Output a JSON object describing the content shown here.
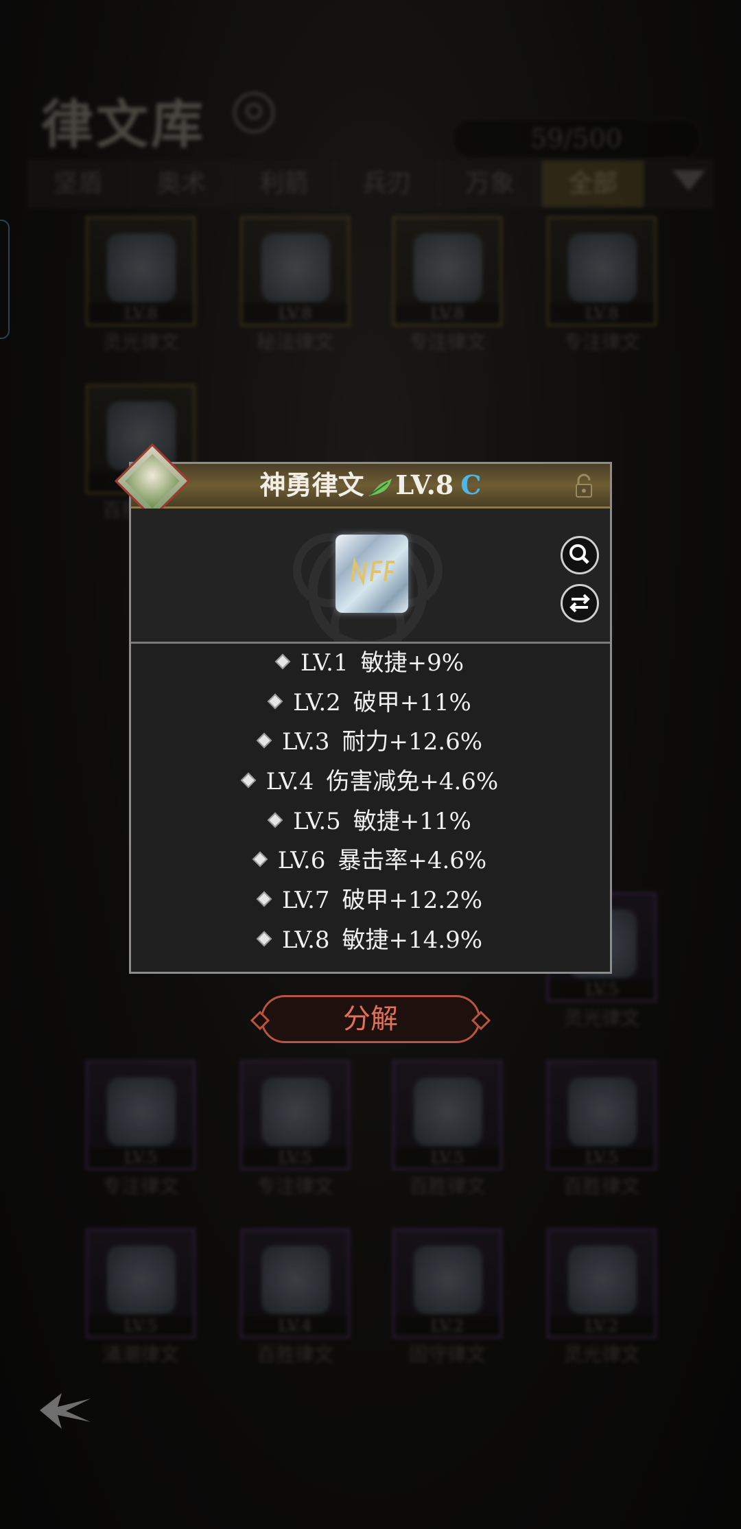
{
  "header": {
    "title": "律文库",
    "counter": "59/500"
  },
  "tabs": [
    {
      "label": "坚盾",
      "active": false
    },
    {
      "label": "奥术",
      "active": false
    },
    {
      "label": "利箭",
      "active": false
    },
    {
      "label": "兵刃",
      "active": false
    },
    {
      "label": "万象",
      "active": false
    },
    {
      "label": "全部",
      "active": true
    }
  ],
  "grid": [
    {
      "lv": "LV.8",
      "name": "灵光律文",
      "rarity": "gold"
    },
    {
      "lv": "LV.8",
      "name": "秘法律文",
      "rarity": "gold"
    },
    {
      "lv": "LV.8",
      "name": "专注律文",
      "rarity": "gold"
    },
    {
      "lv": "LV.8",
      "name": "专注律文",
      "rarity": "gold"
    },
    {
      "lv": "LV.5",
      "name": "百胜律文",
      "rarity": "gold"
    },
    {
      "lv": "LV.5",
      "name": "灵光律文",
      "rarity": "purple"
    },
    {
      "lv": "LV.5",
      "name": "专注律文",
      "rarity": "purple"
    },
    {
      "lv": "LV.5",
      "name": "专注律文",
      "rarity": "purple"
    },
    {
      "lv": "LV.5",
      "name": "百胜律文",
      "rarity": "purple"
    },
    {
      "lv": "LV.5",
      "name": "百胜律文",
      "rarity": "purple"
    },
    {
      "lv": "LV.5",
      "name": "涌潮律文",
      "rarity": "purple"
    },
    {
      "lv": "LV.4",
      "name": "百胜律文",
      "rarity": "purple"
    },
    {
      "lv": "LV.2",
      "name": "固守律文",
      "rarity": "purple"
    },
    {
      "lv": "LV.2",
      "name": "灵光律文",
      "rarity": "purple"
    }
  ],
  "popup": {
    "name": "神勇律文",
    "level": "LV.8",
    "grade": "C",
    "stats": [
      {
        "lv": "LV.1",
        "text": "敏捷+9%"
      },
      {
        "lv": "LV.2",
        "text": "破甲+11%"
      },
      {
        "lv": "LV.3",
        "text": "耐力+12.6%"
      },
      {
        "lv": "LV.4",
        "text": "伤害减免+4.6%"
      },
      {
        "lv": "LV.5",
        "text": "敏捷+11%"
      },
      {
        "lv": "LV.6",
        "text": "暴击率+4.6%"
      },
      {
        "lv": "LV.7",
        "text": "破甲+12.2%"
      },
      {
        "lv": "LV.8",
        "text": "敏捷+14.9%"
      }
    ]
  },
  "actions": {
    "decompose": "分解"
  },
  "colors": {
    "grade": "#4fb6e6",
    "decompose": "#e0715a",
    "gold_frame": "#8a6f2e",
    "purple_frame": "#6c3d8a"
  },
  "icons": [
    "search-icon",
    "filter-icon",
    "lock-icon",
    "magnify-icon",
    "swap-icon",
    "back-icon",
    "leaf-icon"
  ]
}
